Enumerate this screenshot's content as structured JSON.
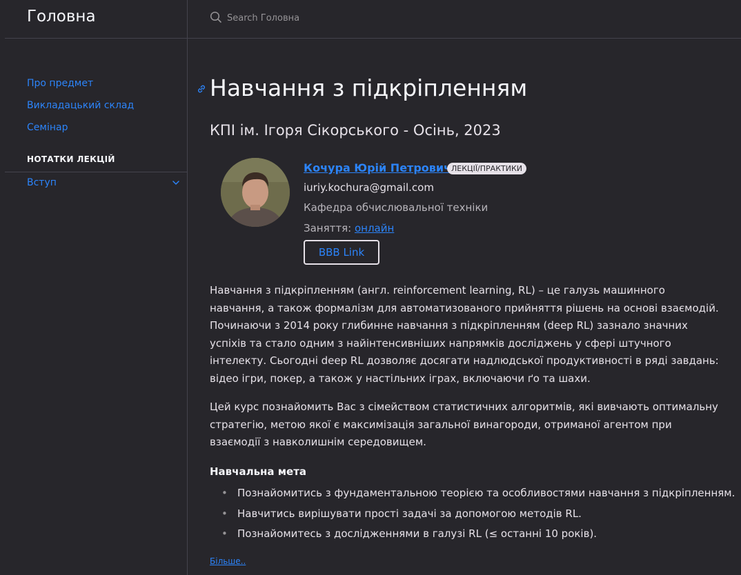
{
  "site": {
    "title": "Головна"
  },
  "search": {
    "placeholder": "Search Головна"
  },
  "sidebar": {
    "items": [
      {
        "label": "Про предмет"
      },
      {
        "label": "Викладацький склад"
      },
      {
        "label": "Семінар"
      }
    ],
    "section_title": "НОТАТКИ ЛЕКЦІЙ",
    "section_items": [
      {
        "label": "Вступ"
      }
    ]
  },
  "main": {
    "title": "Навчання з підкріпленням",
    "subtitle": "КПІ ім. Ігоря Сікорського - Осінь, 2023",
    "instructor": {
      "name": "Кочура Юрій Петрович",
      "role_badge": "ЛЕКЦІЇ/ПРАКТИКИ",
      "email": "iuriy.kochura@gmail.com",
      "department": "Кафедра обчислювальної техніки",
      "sessions_label": "Заняття:",
      "sessions_link": "онлайн",
      "bbb_button": "BBB Link"
    },
    "paragraphs": [
      "Навчання з підкріпленням (англ. reinforcement learning, RL) – це галузь машинного навчання, а також формалізм для автоматизованого прийняття рішень на основі взаємодій. Починаючи з 2014 року глибинне навчання з підкріпленням (deep RL) зазнало значних успіхів та стало одним з найінтенсивніших напрямків досліджень у сфері штучного інтелекту. Сьогодні deep RL дозволяє досягати надлюдської продуктивності в ряді завдань: відео ігри, покер, а також у настільних іграх, включаючи ґо та шахи.",
      "Цей курс познайомить Вас з сімейством статистичних алгоритмів, які вивчають оптимальну стратегію, метою якої є максимізація загальної винагороди, отриманої агентом при взаємодії з навколишнім середовищем."
    ],
    "goals_title": "Навчальна мета",
    "goals": [
      "Познайомитись з фундаментальною теорією та особливостями навчання з підкріпленням.",
      "Навчитись вирішувати прості задачі за допомогою методів RL.",
      "Познайомитесь з дослідженнями в галузі RL (≤ останні 10 років)."
    ],
    "more_link": "Більше.."
  }
}
